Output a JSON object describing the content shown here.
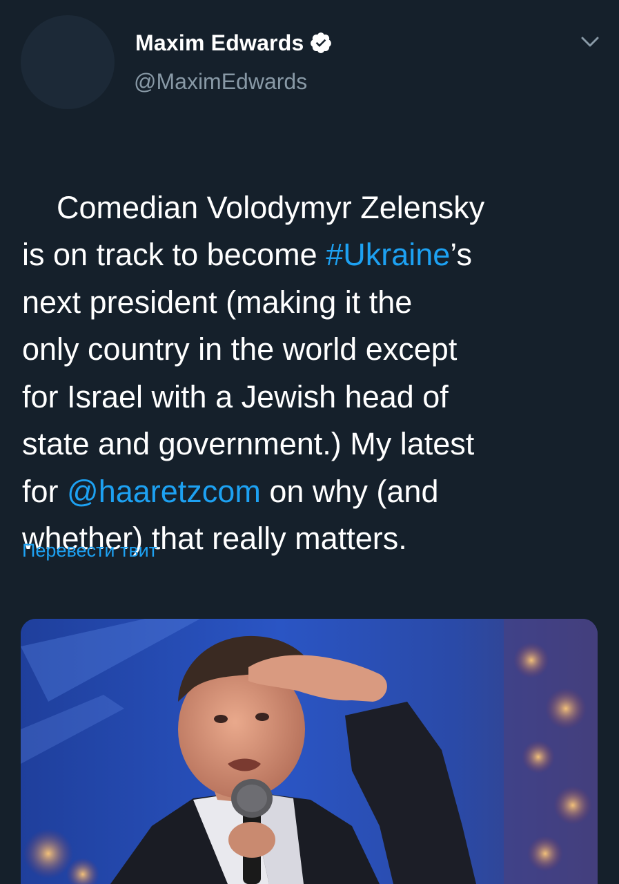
{
  "author": {
    "display_name": "Maxim Edwards",
    "handle": "@MaximEdwards",
    "verified": true
  },
  "tweet": {
    "segments": [
      {
        "text": "Comedian Volodymyr Zelensky\nis on track to become ",
        "link": false
      },
      {
        "text": "#Ukraine",
        "link": true
      },
      {
        "text": "’s\nnext president (making it the\nonly country in the world except\nfor Israel with a Jewish head of\nstate and government.) My latest\nfor ",
        "link": false
      },
      {
        "text": "@haaretzcom",
        "link": true
      },
      {
        "text": " on why (and\nwhether) that really matters.",
        "link": false
      }
    ]
  },
  "translate_label": "Перевести твит",
  "colors": {
    "background": "#15202b",
    "link": "#1da1f2",
    "secondary_text": "#8899a6",
    "verified_badge": "#ffffff"
  },
  "icons": {
    "verified": "verified-badge-icon",
    "menu": "chevron-down-icon"
  }
}
